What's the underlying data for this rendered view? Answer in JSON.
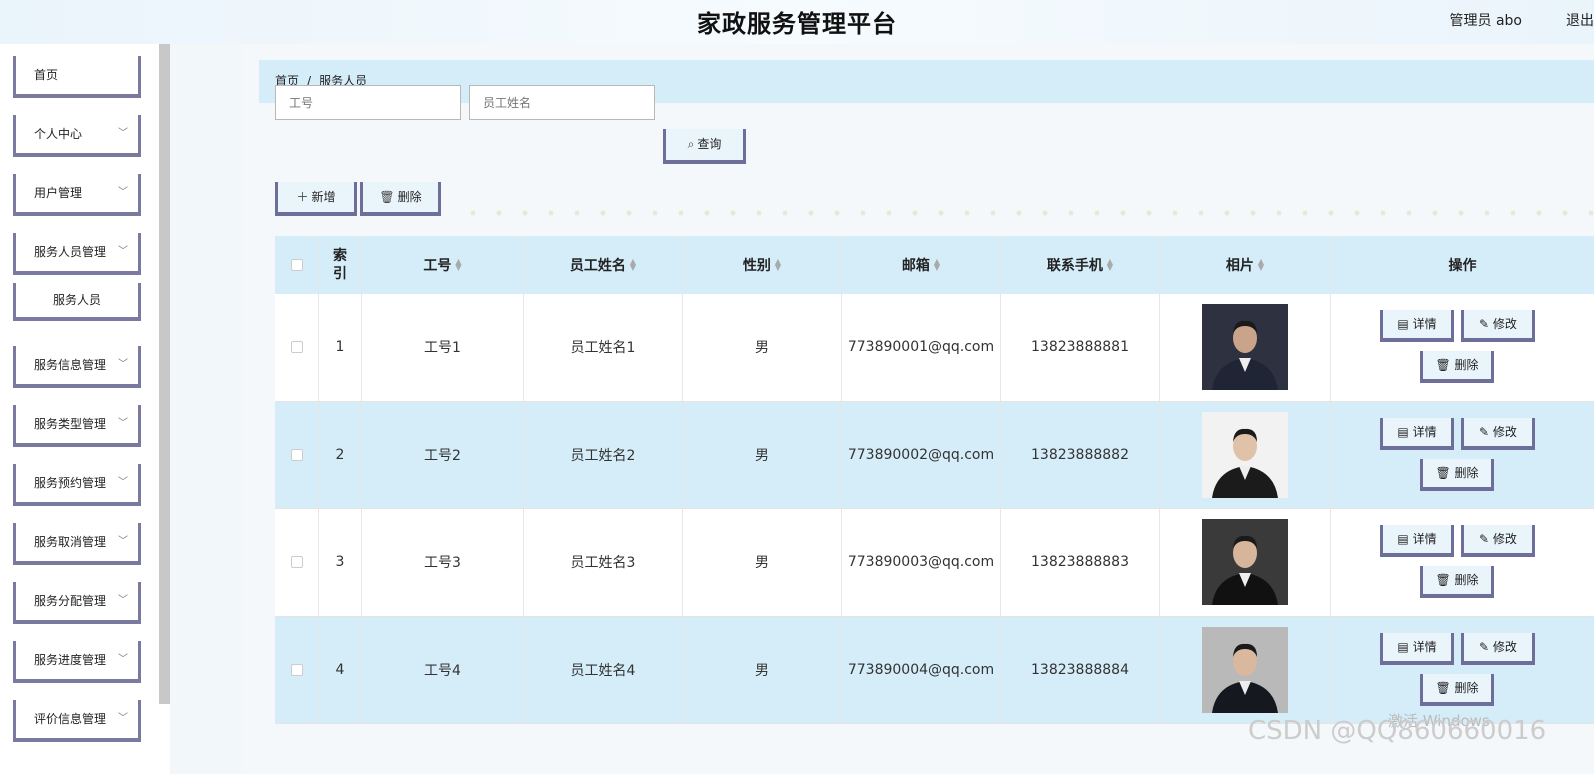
{
  "header": {
    "title": "家政服务管理平台",
    "admin_label": "管理员 abo",
    "logout_label": "退出"
  },
  "sidebar": {
    "items": [
      {
        "label": "首页",
        "expandable": false
      },
      {
        "label": "个人中心",
        "expandable": true
      },
      {
        "label": "用户管理",
        "expandable": true
      },
      {
        "label": "服务人员管理",
        "expandable": true
      },
      {
        "label": "服务人员",
        "expandable": false,
        "sub": true
      },
      {
        "label": "服务信息管理",
        "expandable": true
      },
      {
        "label": "服务类型管理",
        "expandable": true
      },
      {
        "label": "服务预约管理",
        "expandable": true
      },
      {
        "label": "服务取消管理",
        "expandable": true
      },
      {
        "label": "服务分配管理",
        "expandable": true
      },
      {
        "label": "服务进度管理",
        "expandable": true
      },
      {
        "label": "评价信息管理",
        "expandable": true
      }
    ]
  },
  "breadcrumb": {
    "home": "首页",
    "separator": "/",
    "current": "服务人员"
  },
  "search": {
    "id_placeholder": "工号",
    "name_placeholder": "员工姓名",
    "query_label": "查询"
  },
  "toolbar": {
    "add_label": "新增",
    "delete_label": "删除"
  },
  "table": {
    "headers": {
      "index": "索引",
      "id": "工号",
      "name": "员工姓名",
      "gender": "性别",
      "email": "邮箱",
      "phone": "联系手机",
      "photo": "相片",
      "actions": "操作"
    },
    "actions": {
      "detail": "详情",
      "edit": "修改",
      "delete": "删除"
    },
    "rows": [
      {
        "index": "1",
        "id": "工号1",
        "name": "员工姓名1",
        "gender": "男",
        "email": "773890001@qq.com",
        "phone": "13823888881"
      },
      {
        "index": "2",
        "id": "工号2",
        "name": "员工姓名2",
        "gender": "男",
        "email": "773890002@qq.com",
        "phone": "13823888882"
      },
      {
        "index": "3",
        "id": "工号3",
        "name": "员工姓名3",
        "gender": "男",
        "email": "773890003@qq.com",
        "phone": "13823888883"
      },
      {
        "index": "4",
        "id": "工号4",
        "name": "员工姓名4",
        "gender": "男",
        "email": "773890004@qq.com",
        "phone": "13823888884"
      }
    ]
  },
  "watermarks": {
    "activate": "激活 Windows",
    "csdn": "CSDN @QQ860660016"
  },
  "colors": {
    "accent": "#d5ecf9",
    "button_border": "#6e6e9a",
    "button_bg": "#eaf4fb"
  }
}
